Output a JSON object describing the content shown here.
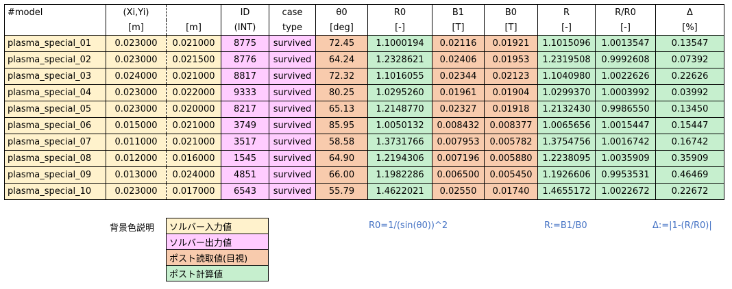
{
  "headers_row1": [
    "#model",
    "(Xi,Yi)",
    "",
    "ID",
    "case",
    "θ0",
    "R0",
    "B1",
    "B0",
    "R",
    "R/R0",
    "Δ"
  ],
  "headers_row2": [
    "",
    "[m]",
    "[m]",
    "(INT)",
    "type",
    "[deg]",
    "[-]",
    "[T]",
    "[T]",
    "[-]",
    "[-]",
    "[%]"
  ],
  "rows": [
    [
      "plasma_special_01",
      "0.023000",
      "0.021000",
      "8775",
      "survived",
      "72.45",
      "1.1000194",
      "0.02116",
      "0.01921",
      "1.1015096",
      "1.0013547",
      "0.13547"
    ],
    [
      "plasma_special_02",
      "0.023000",
      "0.021500",
      "8776",
      "survived",
      "64.24",
      "1.2328621",
      "0.02406",
      "0.01953",
      "1.2319508",
      "0.9992608",
      "0.07392"
    ],
    [
      "plasma_special_03",
      "0.024000",
      "0.021000",
      "8817",
      "survived",
      "72.32",
      "1.1016055",
      "0.02344",
      "0.02123",
      "1.1040980",
      "1.0022626",
      "0.22626"
    ],
    [
      "plasma_special_04",
      "0.023000",
      "0.022000",
      "9333",
      "survived",
      "80.25",
      "1.0295260",
      "0.01961",
      "0.01904",
      "1.0299370",
      "1.0003992",
      "0.03992"
    ],
    [
      "plasma_special_05",
      "0.023000",
      "0.020000",
      "8217",
      "survived",
      "65.13",
      "1.2148770",
      "0.02327",
      "0.01918",
      "1.2132430",
      "0.9986550",
      "0.13450"
    ],
    [
      "plasma_special_06",
      "0.015000",
      "0.021000",
      "3749",
      "survived",
      "85.95",
      "1.0050132",
      "0.008432",
      "0.008377",
      "1.0065656",
      "1.0015447",
      "0.15447"
    ],
    [
      "plasma_special_07",
      "0.011000",
      "0.021000",
      "3517",
      "survived",
      "58.58",
      "1.3731766",
      "0.007953",
      "0.005782",
      "1.3754756",
      "1.0016742",
      "0.16742"
    ],
    [
      "plasma_special_08",
      "0.012000",
      "0.016000",
      "1545",
      "survived",
      "64.90",
      "1.2194306",
      "0.007196",
      "0.005880",
      "1.2238095",
      "1.0035909",
      "0.35909"
    ],
    [
      "plasma_special_09",
      "0.013000",
      "0.024000",
      "4851",
      "survived",
      "66.00",
      "1.1982286",
      "0.006500",
      "0.005450",
      "1.1926606",
      "0.9953531",
      "0.46469"
    ],
    [
      "plasma_special_10",
      "0.023000",
      "0.017000",
      "6543",
      "survived",
      "55.79",
      "1.4622021",
      "0.02550",
      "0.01740",
      "1.4655172",
      "1.0022672",
      "0.22672"
    ]
  ],
  "legend": {
    "title": "背景色説明",
    "items": [
      {
        "label": "ソルバー入力値",
        "color": "#fff2cc"
      },
      {
        "label": "ソルバー出力値",
        "color": "#ffccff"
      },
      {
        "label": "ポスト読取値(目視)",
        "color": "#f8cbad"
      },
      {
        "label": "ポスト計算値",
        "color": "#c6efce"
      }
    ]
  },
  "formulas": {
    "r0": "R0=1/(sin(θ0))^2",
    "r": "R:=B1/B0",
    "delta": "Δ:=|1-(R/R0)|"
  },
  "colors": {
    "input": "#fff2cc",
    "output": "#ffccff",
    "read": "#f8cbad",
    "calc": "#c6efce",
    "formula_text": "#4472c4"
  }
}
